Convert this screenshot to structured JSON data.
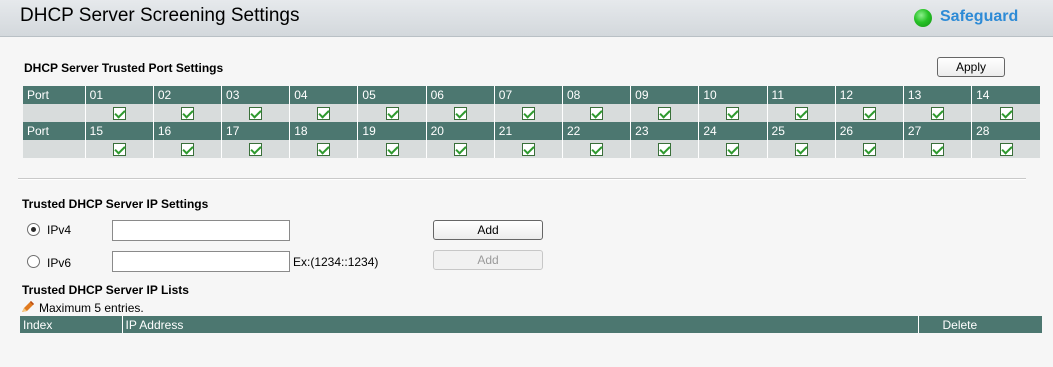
{
  "header": {
    "title": "DHCP Server Screening Settings",
    "status_label": "Safeguard",
    "status_color": "#27c227"
  },
  "trusted_ports": {
    "title": "DHCP Server Trusted Port Settings",
    "apply_label": "Apply",
    "row_label": "Port",
    "ports_row1": [
      "01",
      "02",
      "03",
      "04",
      "05",
      "06",
      "07",
      "08",
      "09",
      "10",
      "11",
      "12",
      "13",
      "14"
    ],
    "ports_row2": [
      "15",
      "16",
      "17",
      "18",
      "19",
      "20",
      "21",
      "22",
      "23",
      "24",
      "25",
      "26",
      "27",
      "28"
    ],
    "all_checked": true
  },
  "ip_settings": {
    "title": "Trusted DHCP Server IP Settings",
    "ipv4_label": "IPv4",
    "ipv6_label": "IPv6",
    "ipv4_value": "",
    "ipv6_value": "",
    "ipv6_hint": "Ex:(1234::1234)",
    "add_label": "Add",
    "selected": "IPv4"
  },
  "ip_lists": {
    "title": "Trusted DHCP Server IP Lists",
    "note": "Maximum 5 entries.",
    "columns": [
      "Index",
      "IP Address",
      "Delete"
    ]
  }
}
